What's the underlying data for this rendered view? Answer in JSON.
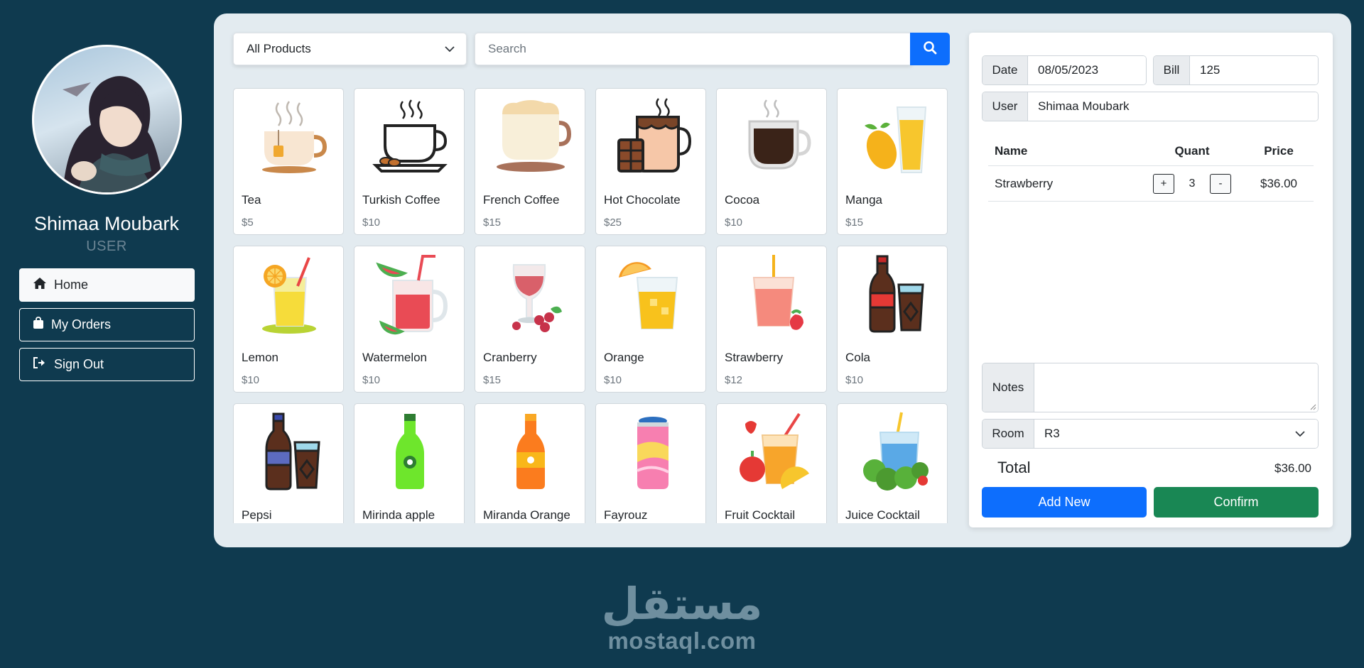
{
  "user": {
    "name": "Shimaa Moubark",
    "role": "USER"
  },
  "nav": [
    {
      "label": "Home",
      "icon": "home-icon",
      "active": true
    },
    {
      "label": "My Orders",
      "icon": "bag-icon",
      "active": false
    },
    {
      "label": "Sign Out",
      "icon": "sign-out-icon",
      "active": false
    }
  ],
  "filter": {
    "selected": "All Products"
  },
  "search": {
    "placeholder": "Search"
  },
  "products": [
    {
      "name": "Tea",
      "price": "$5",
      "icon": "tea-cup-icon"
    },
    {
      "name": "Turkish Coffee",
      "price": "$10",
      "icon": "coffee-cup-icon"
    },
    {
      "name": "French Coffee",
      "price": "$15",
      "icon": "latte-cup-icon"
    },
    {
      "name": "Hot Chocolate",
      "price": "$25",
      "icon": "hot-chocolate-icon"
    },
    {
      "name": "Cocoa",
      "price": "$10",
      "icon": "cocoa-glass-icon"
    },
    {
      "name": "Manga",
      "price": "$15",
      "icon": "mango-juice-icon"
    },
    {
      "name": "Lemon",
      "price": "$10",
      "icon": "lemonade-icon"
    },
    {
      "name": "Watermelon",
      "price": "$10",
      "icon": "watermelon-juice-icon"
    },
    {
      "name": "Cranberry",
      "price": "$15",
      "icon": "cranberry-drink-icon"
    },
    {
      "name": "Orange",
      "price": "$10",
      "icon": "orange-juice-icon"
    },
    {
      "name": "Strawberry",
      "price": "$12",
      "icon": "strawberry-juice-icon"
    },
    {
      "name": "Cola",
      "price": "$10",
      "icon": "cola-bottle-icon"
    },
    {
      "name": "Pepsi",
      "price": "",
      "icon": "pepsi-bottle-icon"
    },
    {
      "name": "Mirinda apple",
      "price": "",
      "icon": "green-soda-icon"
    },
    {
      "name": "Miranda Orange",
      "price": "",
      "icon": "orange-soda-icon"
    },
    {
      "name": "Fayrouz",
      "price": "",
      "icon": "soda-can-icon"
    },
    {
      "name": "Fruit Cocktail",
      "price": "",
      "icon": "fruit-cocktail-icon"
    },
    {
      "name": "Juice Cocktail",
      "price": "",
      "icon": "juice-cocktail-icon"
    }
  ],
  "order": {
    "date_label": "Date",
    "date_value": "08/05/2023",
    "bill_label": "Bill",
    "bill_value": "125",
    "user_label": "User",
    "user_value": "Shimaa Moubark",
    "columns": {
      "name": "Name",
      "quant": "Quant",
      "price": "Price"
    },
    "items": [
      {
        "name": "Strawberry",
        "plus": "+",
        "quantity": "3",
        "minus": "-",
        "price": "$36.00"
      }
    ],
    "notes_label": "Notes",
    "notes_value": "",
    "room_label": "Room",
    "room_value": "R3",
    "total_label": "Total",
    "total_value": "$36.00",
    "add_new_label": "Add New",
    "confirm_label": "Confirm"
  },
  "brand": {
    "arabic": "مستقل",
    "latin": "mostaql.com"
  },
  "colors": {
    "background": "#0f3a4f",
    "panel": "#e3ebf0",
    "primary": "#0d6efd",
    "success": "#198754",
    "brand": "#6f8f9f"
  }
}
